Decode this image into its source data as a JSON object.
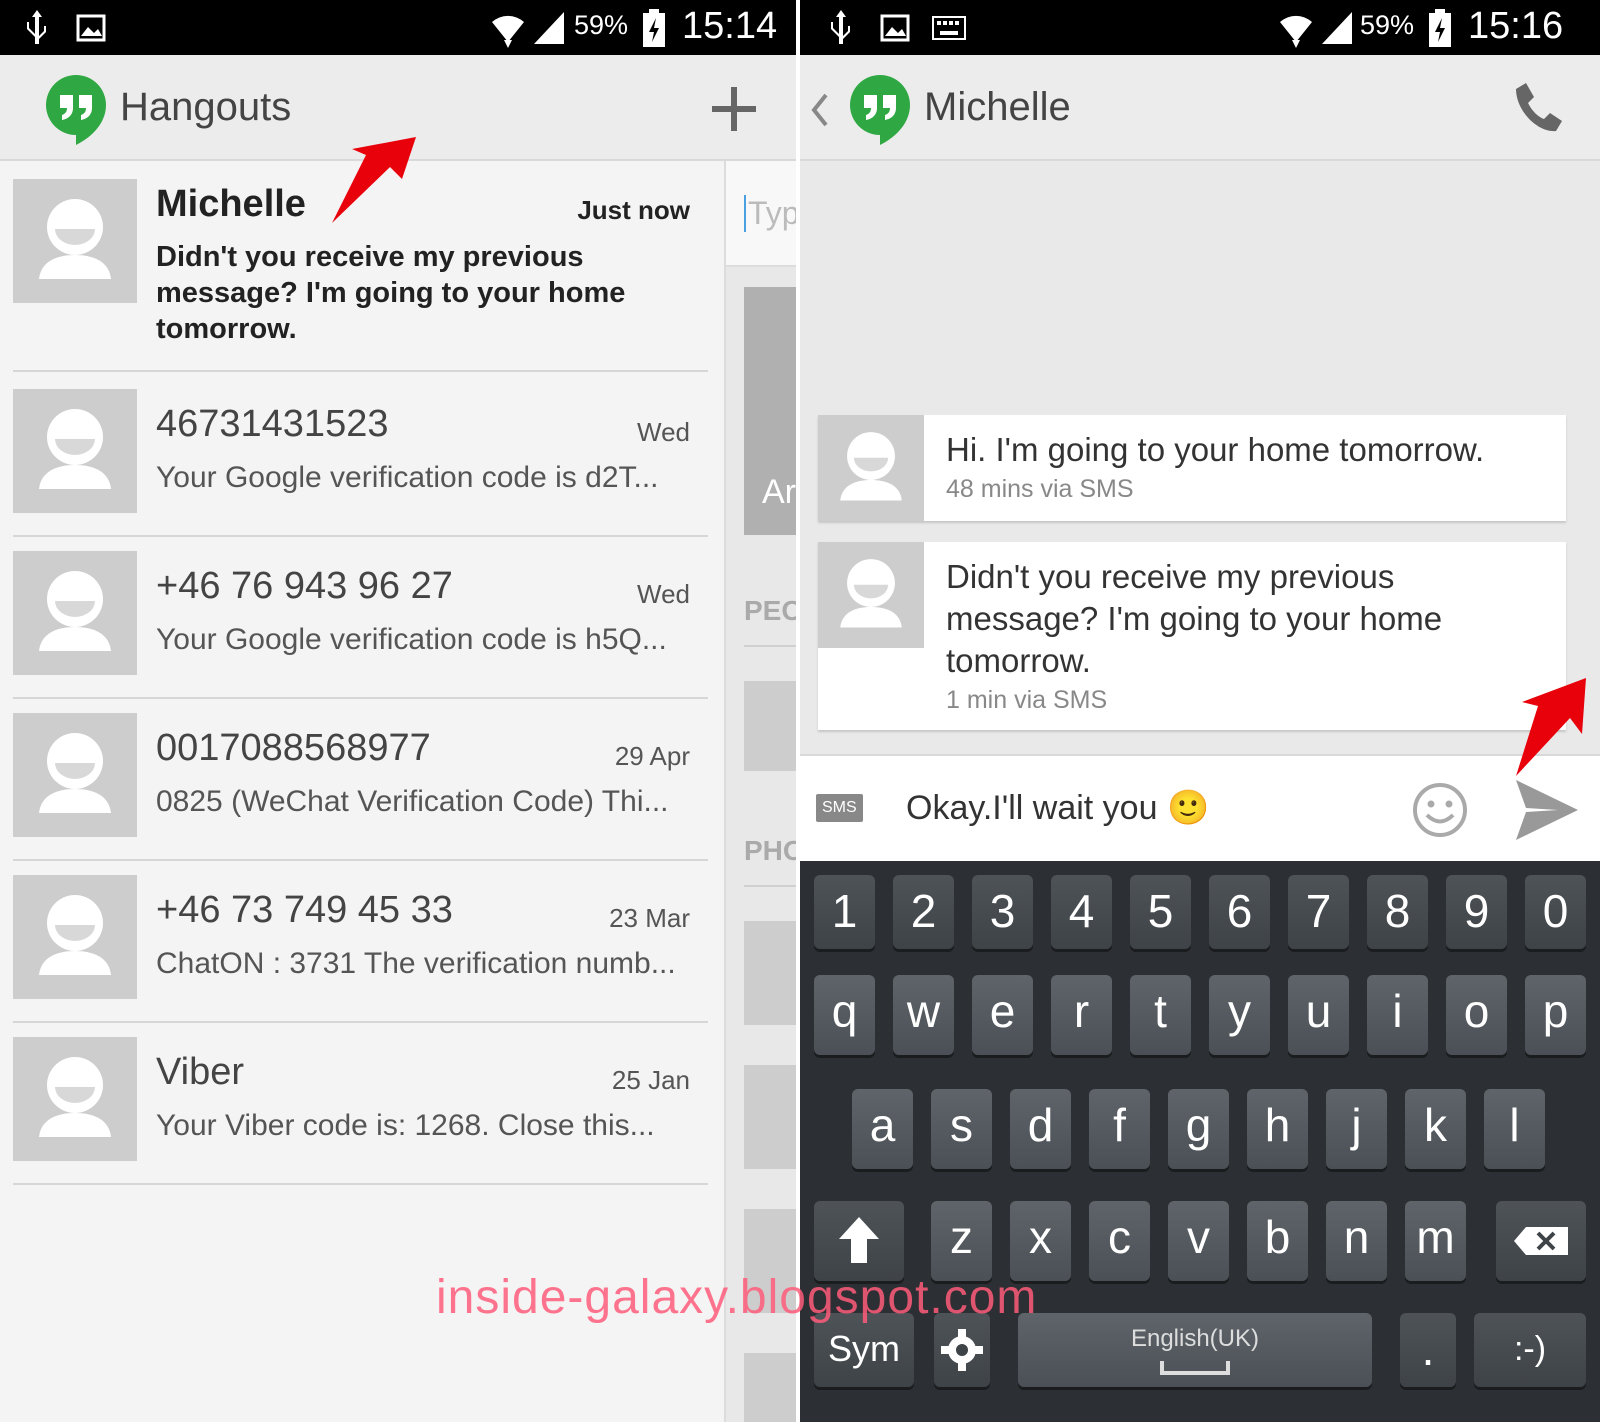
{
  "left": {
    "status": {
      "battery": "59%",
      "time": "15:14"
    },
    "app_title": "Hangouts",
    "conversations": [
      {
        "name": "Michelle",
        "time": "Just now",
        "snippet": "Didn't you receive my previous message? I'm going to your home tomorrow."
      },
      {
        "name": "46731431523",
        "time": "Wed",
        "snippet": "Your Google verification code is d2T..."
      },
      {
        "name": "+46 76 943 96 27",
        "time": "Wed",
        "snippet": "Your Google verification code is h5Q..."
      },
      {
        "name": "0017088568977",
        "time": "29 Apr",
        "snippet": "0825 (WeChat Verification Code) Thi..."
      },
      {
        "name": "+46 73 749 45 33",
        "time": "23 Mar",
        "snippet": "ChatON : 3731 The verification numb..."
      },
      {
        "name": "Viber",
        "time": "25 Jan",
        "snippet": "Your Viber code is: 1268. Close this..."
      }
    ],
    "peek": {
      "placeholder": "Typ",
      "card_text": "Ar",
      "section_people": "PEO",
      "section_phone": "PHO"
    }
  },
  "right": {
    "status": {
      "battery": "59%",
      "time": "15:16"
    },
    "contact_name": "Michelle",
    "messages": [
      {
        "text": "Hi. I'm going to your home tomorrow.",
        "meta": "48 mins via SMS"
      },
      {
        "text": "Didn't you receive my previous message? I'm going to your home tomorrow.",
        "meta": "1 min via SMS"
      }
    ],
    "compose": {
      "mode": "SMS",
      "value": "Okay.I'll wait you 🙂"
    },
    "keyboard": {
      "row_numbers": [
        "1",
        "2",
        "3",
        "4",
        "5",
        "6",
        "7",
        "8",
        "9",
        "0"
      ],
      "row1": [
        "q",
        "w",
        "e",
        "r",
        "t",
        "y",
        "u",
        "i",
        "o",
        "p"
      ],
      "row2": [
        "a",
        "s",
        "d",
        "f",
        "g",
        "h",
        "j",
        "k",
        "l"
      ],
      "row3": [
        "z",
        "x",
        "c",
        "v",
        "b",
        "n",
        "m"
      ],
      "sym": "Sym",
      "space_label": "English(UK)",
      "period": ".",
      "smiley": ":-)"
    }
  },
  "watermark": "inside-galaxy.blogspot.com",
  "colors": {
    "hangouts_green": "#2fa843",
    "arrow_red": "#e8000b"
  }
}
